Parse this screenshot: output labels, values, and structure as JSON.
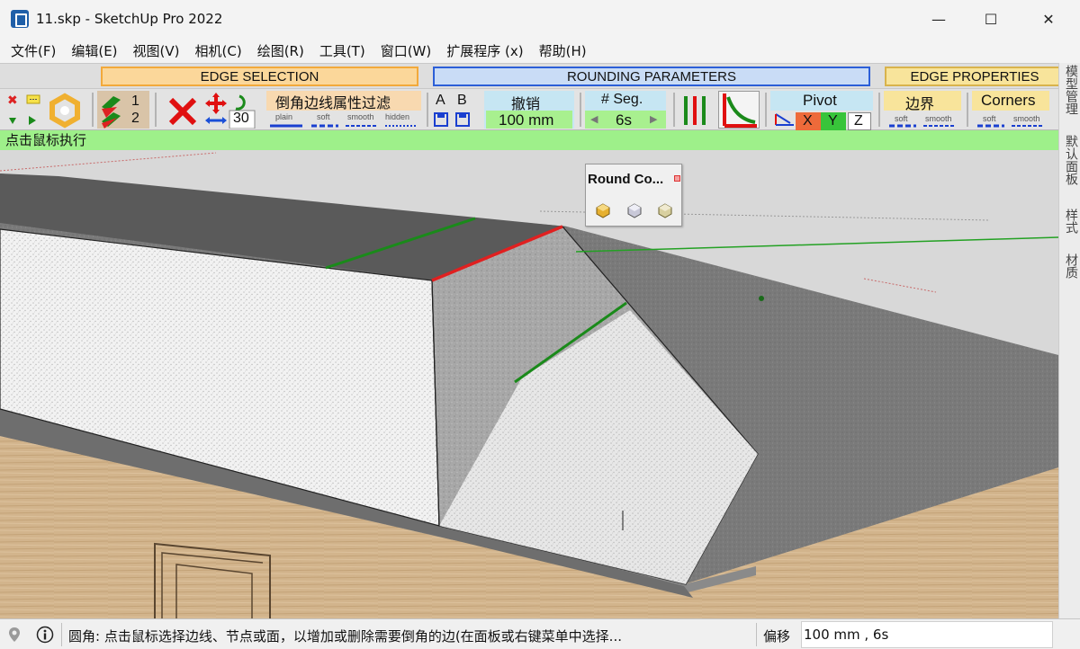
{
  "window": {
    "title": "11.skp - SketchUp Pro 2022",
    "minimize": "—",
    "maximize": "☐",
    "close": "✕"
  },
  "menu": [
    "文件(F)",
    "编辑(E)",
    "视图(V)",
    "相机(C)",
    "绘图(R)",
    "工具(T)",
    "窗口(W)",
    "扩展程序 (x)",
    "帮助(H)"
  ],
  "groups": {
    "edge_selection": "EDGE SELECTION",
    "rounding": "ROUNDING PARAMETERS",
    "edge_properties": "EDGE PROPERTIES"
  },
  "toolbar": {
    "step_one": "1",
    "step_two": "2",
    "angle_value": "30",
    "filter_title": "倒角边线属性过滤",
    "filter_plain": "plain",
    "filter_soft": "soft",
    "filter_smooth": "smooth",
    "filter_hidden": "hidden",
    "label_a": "A",
    "label_b": "B",
    "offset_title": "撤销",
    "offset_value": "100 mm",
    "seg_title": "# Seg.",
    "seg_value": "6s",
    "pivot_title": "Pivot",
    "axis_x": "X",
    "axis_y": "Y",
    "axis_z": "Z",
    "border_title": "边界",
    "border_soft": "soft",
    "border_smooth": "smooth",
    "corners_title": "Corners",
    "corners_soft": "soft",
    "corners_smooth": "smooth"
  },
  "hint": "点击鼠标执行",
  "side_tabs": [
    "模型管理",
    "默认面板",
    "样式",
    "材质"
  ],
  "round_panel": {
    "title": "Round Co..."
  },
  "status": {
    "message": "圆角: 点击鼠标选择边线、节点或面，以增加或删除需要倒角的边(在面板或右键菜单中选择...",
    "vcb_label": "偏移",
    "vcb_value": "100 mm , 6s"
  },
  "colors": {
    "hint_green": "#9ef08a",
    "selected_edge": "#e02020",
    "rounding_line": "#1a8a1a",
    "axis_green": "#23a123",
    "axis_red": "#c03030"
  }
}
